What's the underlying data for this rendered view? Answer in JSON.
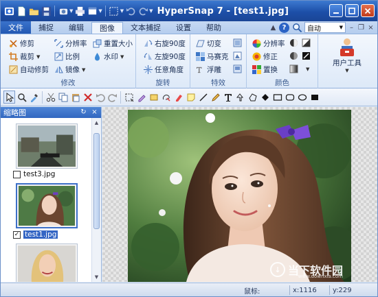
{
  "window": {
    "title": "HyperSnap 7 - [test1.jpg]"
  },
  "menu": {
    "file": "文件",
    "tabs": [
      "捕捉",
      "编辑",
      "图像",
      "文本捕捉",
      "设置",
      "帮助"
    ],
    "active_tab": "图像",
    "zoom": "自动"
  },
  "ribbon": {
    "groups": {
      "modify": {
        "caption": "修改",
        "items": [
          "修剪",
          "分辨率",
          "重置大小",
          "裁剪",
          "比例",
          "水印",
          "自动修剪",
          "镜像"
        ]
      },
      "rotate": {
        "caption": "旋转",
        "items": [
          "右旋90度",
          "左旋90度",
          "任意角度"
        ]
      },
      "effects": {
        "caption": "特效",
        "items": [
          "切变",
          "马赛克",
          "浮雕"
        ]
      },
      "color": {
        "caption": "颜色",
        "items": [
          "分辨率",
          "修正",
          "置换"
        ]
      },
      "user": {
        "label": "用户工具"
      }
    }
  },
  "toolbar": {
    "tools": [
      "select-arrow",
      "zoom",
      "color-picker",
      "crop",
      "copy",
      "paste",
      "delete",
      "undo",
      "redo",
      "rect-select",
      "highlight",
      "stamp",
      "freehand",
      "pencil",
      "note",
      "line",
      "pen",
      "text",
      "callout",
      "polygon",
      "fill",
      "rectangle",
      "rounded-rect",
      "ellipse",
      "shape"
    ]
  },
  "thumbnails": {
    "title": "缩略图",
    "items": [
      {
        "name": "test3.jpg",
        "checked": false,
        "selected": false
      },
      {
        "name": "test1.jpg",
        "checked": true,
        "selected": true
      },
      {
        "name": "",
        "checked": false,
        "selected": false
      }
    ]
  },
  "watermark": {
    "text": "当下软件园",
    "url": "www.downxia.com"
  },
  "status": {
    "label": "鼠标:",
    "x": "x:1116",
    "y": "y:229"
  },
  "colors": {
    "title_bar": "#1d4fa8",
    "accent": "#3267c0",
    "ribbon": "#dde9f8"
  }
}
